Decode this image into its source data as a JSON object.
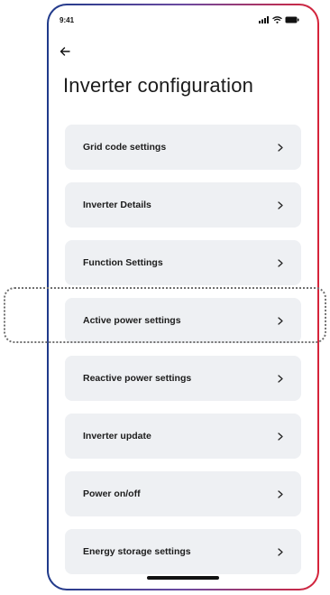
{
  "status_bar": {
    "time": "9:41",
    "icons": [
      "signal-icon",
      "wifi-icon",
      "battery-icon"
    ]
  },
  "nav": {
    "back_icon": "arrow-left-icon"
  },
  "page": {
    "title": "Inverter configuration"
  },
  "settings": {
    "items": [
      {
        "label": "Grid code settings",
        "chevron": ">"
      },
      {
        "label": "Inverter Details",
        "chevron": ">"
      },
      {
        "label": "Function Settings",
        "chevron": ">"
      },
      {
        "label": "Active power settings",
        "chevron": ">"
      },
      {
        "label": "Reactive power settings",
        "chevron": ">"
      },
      {
        "label": "Inverter update",
        "chevron": ">"
      },
      {
        "label": "Power on/off",
        "chevron": ">"
      },
      {
        "label": "Energy storage settings",
        "chevron": ">"
      }
    ]
  },
  "colors": {
    "frame_gradient_start": "#1f3a8a",
    "frame_gradient_end": "#d6243a",
    "item_background": "#eef0f3",
    "text": "#1c1c1c"
  }
}
